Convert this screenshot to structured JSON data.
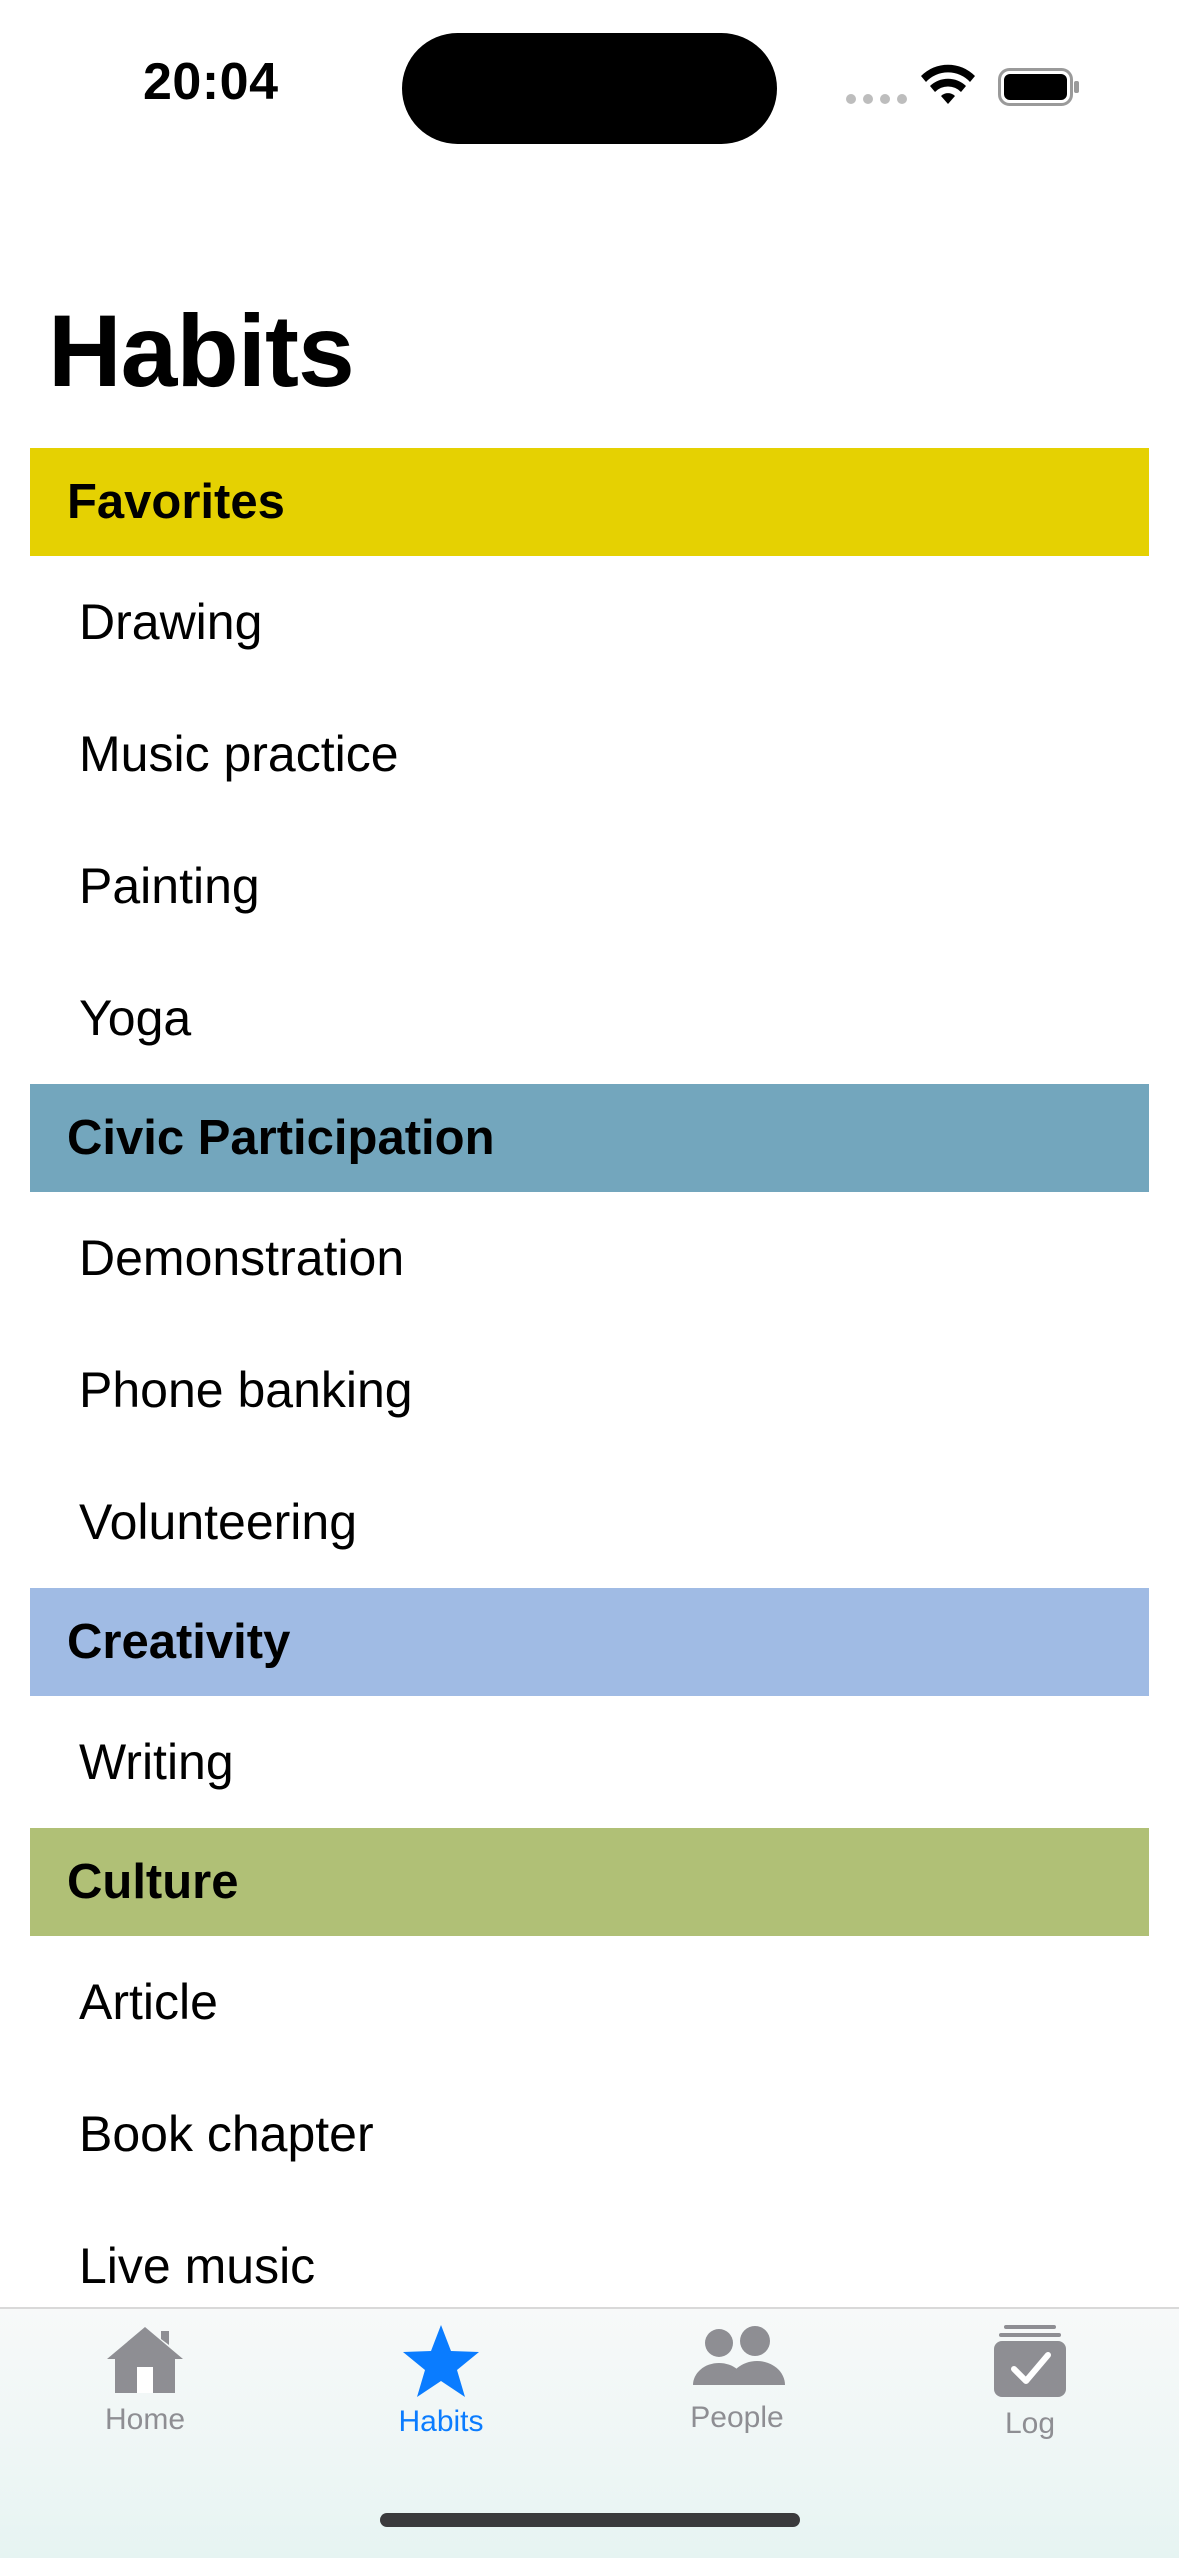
{
  "status": {
    "time": "20:04"
  },
  "page": {
    "title": "Habits"
  },
  "sections": [
    {
      "title": "Favorites",
      "color": "#e5d102",
      "items": [
        "Drawing",
        "Music practice",
        "Painting",
        "Yoga"
      ]
    },
    {
      "title": "Civic Participation",
      "color": "#73a6bd",
      "items": [
        "Demonstration",
        "Phone banking",
        "Volunteering"
      ]
    },
    {
      "title": "Creativity",
      "color": "#a0bbe4",
      "items": [
        "Writing"
      ]
    },
    {
      "title": "Culture",
      "color": "#b0c076",
      "items": [
        "Article",
        "Book chapter",
        "Live music"
      ]
    }
  ],
  "tabs": [
    {
      "label": "Home",
      "icon": "house-icon",
      "active": false
    },
    {
      "label": "Habits",
      "icon": "star-icon",
      "active": true
    },
    {
      "label": "People",
      "icon": "people-icon",
      "active": false
    },
    {
      "label": "Log",
      "icon": "checklist-icon",
      "active": false
    }
  ],
  "colors": {
    "accent": "#0a7cff",
    "inactive": "#8e8e93"
  }
}
